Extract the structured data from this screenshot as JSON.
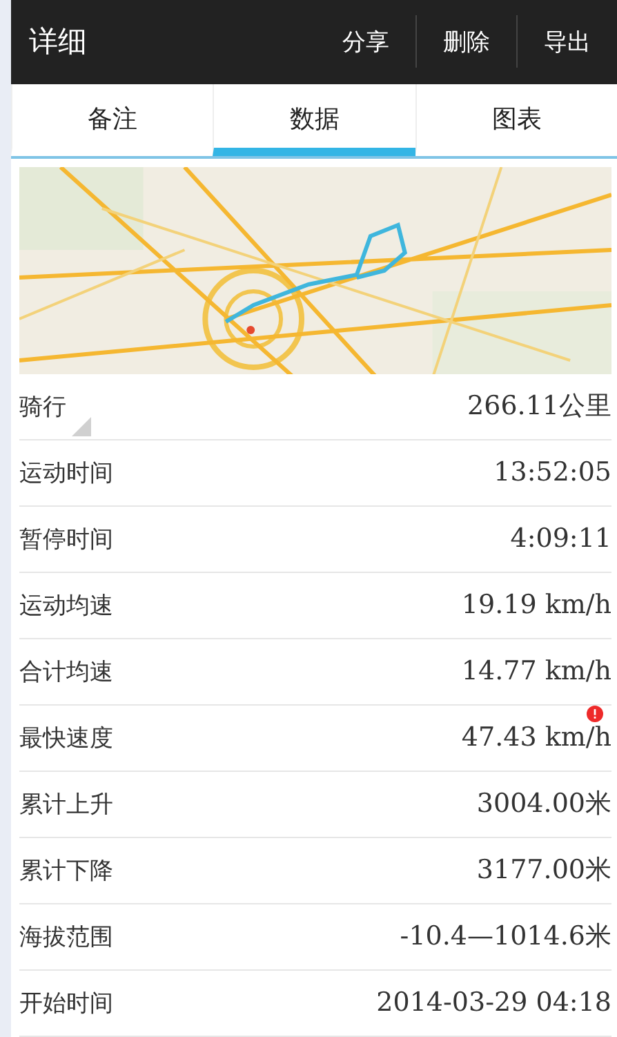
{
  "header": {
    "title": "详细",
    "actions": [
      "分享",
      "删除",
      "导出"
    ]
  },
  "tabs": [
    {
      "label": "备注",
      "selected": false
    },
    {
      "label": "数据",
      "selected": true
    },
    {
      "label": "图表",
      "selected": false
    }
  ],
  "stats": [
    {
      "label": "骑行",
      "value": "266.11公里",
      "kind": "corner"
    },
    {
      "label": "运动时间",
      "value": "13:52:05",
      "kind": "plain"
    },
    {
      "label": "暂停时间",
      "value": "4:09:11",
      "kind": "plain"
    },
    {
      "label": "运动均速",
      "value": "19.19 km/h",
      "kind": "plain"
    },
    {
      "label": "合计均速",
      "value": "14.77 km/h",
      "kind": "plain"
    },
    {
      "label": "最快速度",
      "value": "47.43 km/h",
      "kind": "alert"
    },
    {
      "label": "累计上升",
      "value": "3004.00米",
      "kind": "plain"
    },
    {
      "label": "累计下降",
      "value": "3177.00米",
      "kind": "plain"
    },
    {
      "label": "海拔范围",
      "value": "-10.4—1014.6米",
      "kind": "plain"
    },
    {
      "label": "开始时间",
      "value": "2014-03-29 04:18",
      "kind": "plain"
    }
  ]
}
